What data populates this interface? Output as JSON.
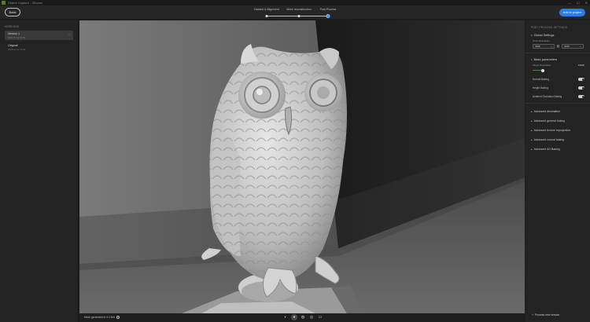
{
  "titlebar": {
    "title": "Object Capture - 3Dconv",
    "controls": [
      "—",
      "☐",
      "✕"
    ]
  },
  "toolbar": {
    "back_label": "Back",
    "steps": [
      "Dataset & Alignment",
      "Mesh reconstruction",
      "Post-Process"
    ],
    "active_step": 2,
    "add_label": "Add to project"
  },
  "versions": {
    "header": "VERSIONS",
    "items": [
      {
        "name": "Version 1",
        "date": "2023-07-12 18:05",
        "selected": true
      },
      {
        "name": "Original",
        "date": "2023-07-12 17:54",
        "selected": false
      }
    ],
    "more_icon": "more-icon"
  },
  "status": {
    "mesh_info": "Mesh generated in 4:2 M/s"
  },
  "view_tools": [
    "wireframe-icon",
    "solid-icon",
    "textured-icon",
    "mixed-icon",
    "camera-icon"
  ],
  "settings": {
    "header": "POST PROCESS SETTINGS",
    "global": {
      "title": "Global Settings",
      "field_label": "Texel Resolution",
      "left_value": "4096",
      "right_value": "4096"
    },
    "basic": {
      "title": "Basic parameters",
      "slider_label": "Target Resolution",
      "slider_value": "10000",
      "slider_fraction": 0.2,
      "toggles": [
        {
          "label": "Normal Baking",
          "on": true
        },
        {
          "label": "Height Baking",
          "on": true
        },
        {
          "label": "Ambient Occlusion Baking",
          "on": true
        }
      ]
    },
    "advanced": [
      "Advanced decimation",
      "Advanced general baking",
      "Advanced texture reprojection",
      "Advanced normal baking",
      "Advanced AO Baking"
    ],
    "process_label": "Process new version"
  }
}
